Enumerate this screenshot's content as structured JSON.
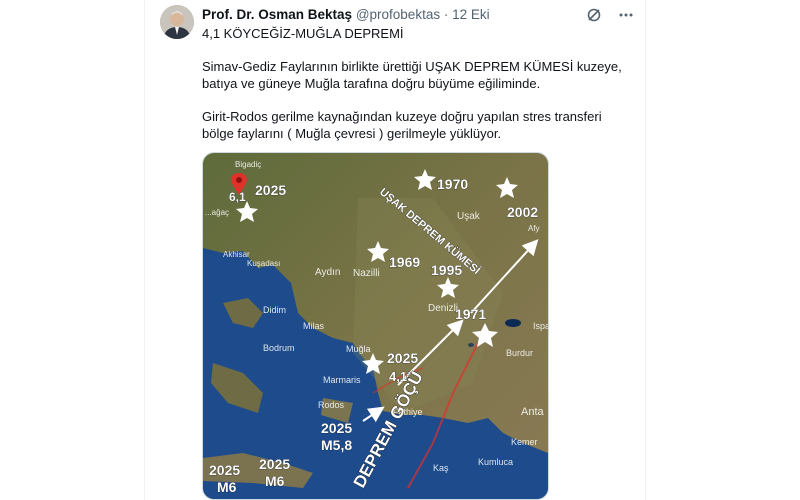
{
  "tweet": {
    "author_name": "Prof. Dr. Osman Bektaş",
    "handle": "@profobektas",
    "separator": "·",
    "date": "12 Eki",
    "title": "4,1 KÖYCEĞİZ-MUĞLA DEPREMİ",
    "paragraph1": "Simav-Gediz Faylarının birlikte ürettiği UŞAK DEPREM KÜMESİ kuzeye, batıya ve güneye Muğla tarafına doğru büyüme eğiliminde.",
    "paragraph2": "Girit-Rodos gerilme kaynağından kuzeye doğru yapılan stres transferi bölge faylarını ( Muğla çevresi ) gerilmeyle yüklüyor."
  },
  "icons": {
    "grok": "grok-icon",
    "more": "more-icon"
  },
  "map": {
    "place_labels": {
      "bigadic": "Bigadiç",
      "akhisar": "Akhisar",
      "kusadasi": "Kuşadası",
      "aydin": "Aydın",
      "nazilli": "Nazilli",
      "usak": "Uşak",
      "denizli": "Denizli",
      "didim": "Didim",
      "milas": "Milas",
      "bodrum": "Bodrum",
      "mugla": "Muğla",
      "marmaris": "Marmaris",
      "rodos": "Rodos",
      "fethiye": "Fethiye",
      "burdur": "Burdur",
      "isparta": "Ispa",
      "antalya": "Anta",
      "kemer": "Kemer",
      "kumluca": "Kumluca",
      "kas": "Kaş",
      "afyon": "Afy",
      "soma": "...ağaç"
    },
    "event_labels": {
      "e2025_simav_mag": "6,1",
      "e2025_simav_year": "2025",
      "e1970": "1970",
      "e2002": "2002",
      "e1969": "1969",
      "e1995": "1995",
      "e1971": "1971",
      "e2025_mugla_year": "2025",
      "e2025_mugla_mag": "4,1",
      "e2025_rodos_year": "2025",
      "e2025_rodos_mag": "M5,8",
      "e2025_a_year": "2025",
      "e2025_a_mag": "M6",
      "e2025_b_year": "2025",
      "e2025_b_mag": "M6"
    },
    "annotations": {
      "usak_cluster": "UŞAK DEPREM KÜMESİ",
      "migration": "DEPREM GÖÇÜ"
    },
    "colors": {
      "sea": "#1b4a8a",
      "land": "#6a6840",
      "pin": "#e0312a",
      "arrow": "#ffffff"
    }
  }
}
